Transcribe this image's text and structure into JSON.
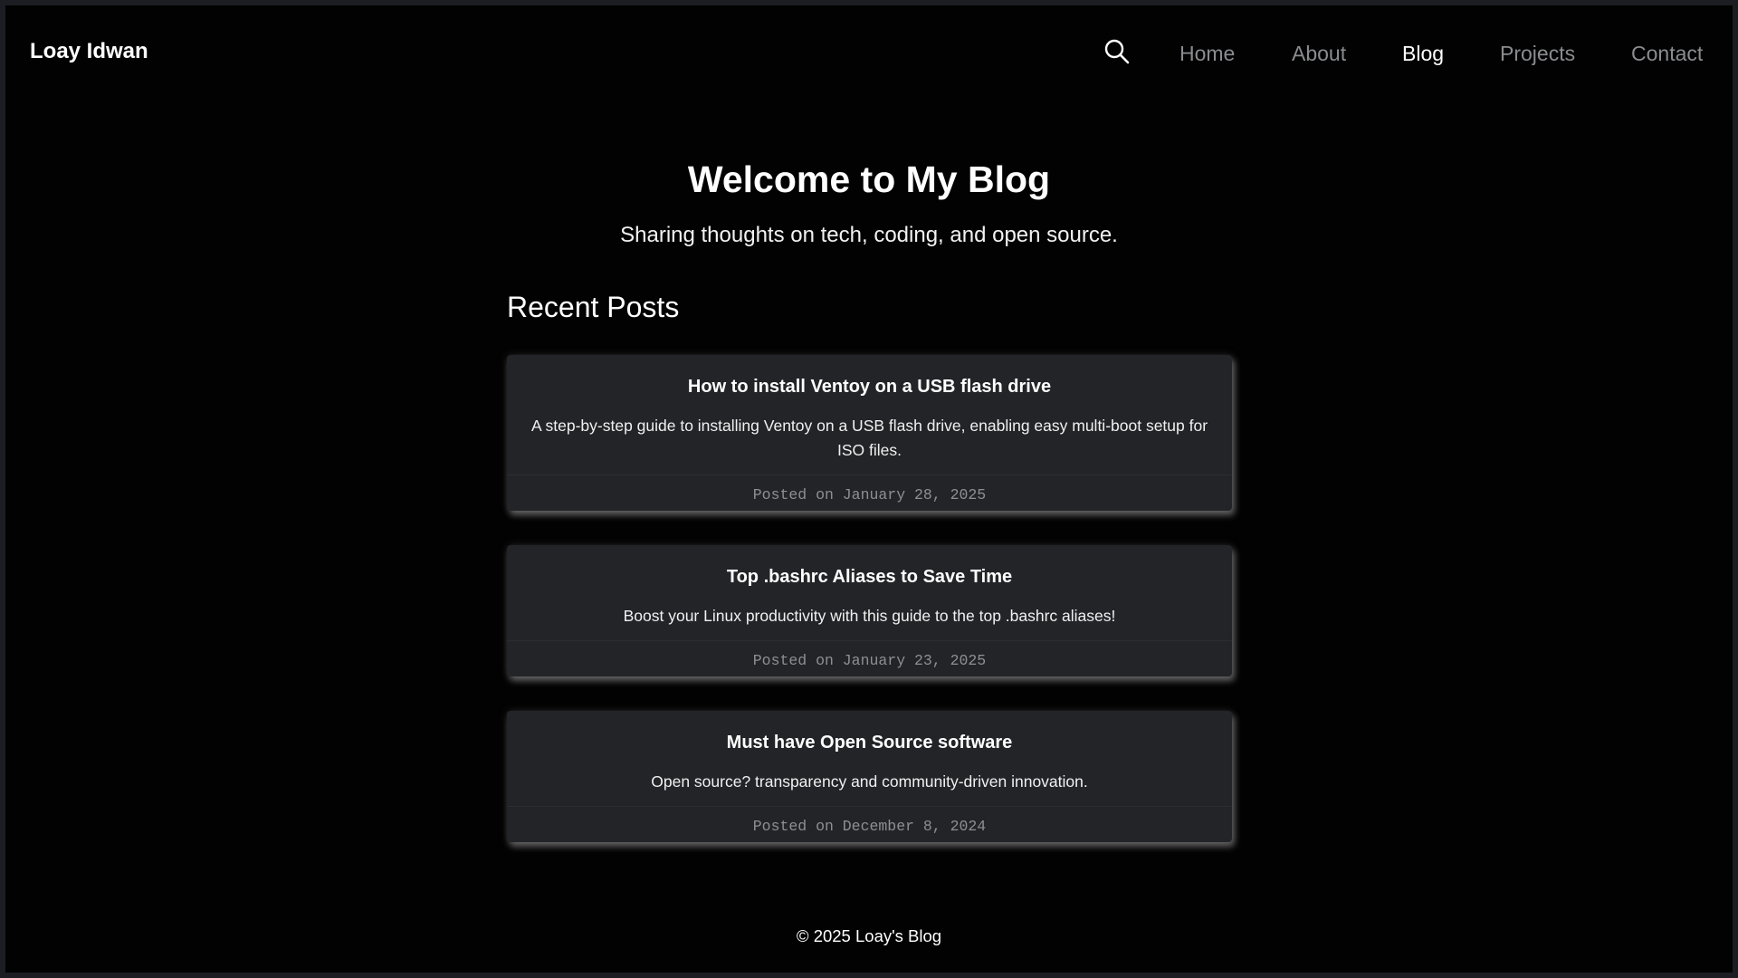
{
  "header": {
    "brand": "Loay Idwan",
    "nav": [
      "Home",
      "About",
      "Blog",
      "Projects",
      "Contact"
    ],
    "active_nav": "Blog",
    "search_icon": "search-icon"
  },
  "hero": {
    "title": "Welcome to My Blog",
    "subtitle": "Sharing thoughts on tech, coding, and open source."
  },
  "recent_posts": {
    "heading": "Recent Posts",
    "posts": [
      {
        "title": "How to install Ventoy on a USB flash drive",
        "excerpt": "A step-by-step guide to installing Ventoy on a USB flash drive, enabling easy multi-boot setup for ISO files.",
        "date": "Posted on January 28, 2025"
      },
      {
        "title": "Top .bashrc Aliases to Save Time",
        "excerpt": "Boost your Linux productivity with this guide to the top .bashrc aliases!",
        "date": "Posted on January 23, 2025"
      },
      {
        "title": "Must have Open Source software",
        "excerpt": "Open source? transparency and community-driven innovation.",
        "date": "Posted on December 8, 2024"
      }
    ]
  },
  "footer": {
    "text": "© 2025 Loay's Blog"
  },
  "colors": {
    "page_background": "#020202",
    "card_background": "#222428",
    "nav_inactive": "#8a8c8f",
    "nav_active": "#ffffff",
    "date_text": "#8d8f92"
  }
}
